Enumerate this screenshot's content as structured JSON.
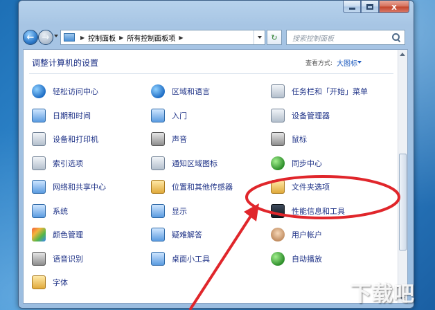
{
  "window": {
    "nav": {
      "back_glyph": "←",
      "forward_glyph": "→",
      "breadcrumb": [
        "控制面板",
        "所有控制面板项"
      ],
      "breadcrumb_sep": "▶",
      "refresh_glyph": "↻",
      "search_placeholder": "搜索控制面板"
    },
    "close_glyph": "x"
  },
  "content": {
    "title": "调整计算机的设置",
    "view_by_label": "查看方式:",
    "view_by_value": "大图标",
    "columns": [
      [
        {
          "label": "轻松访问中心",
          "icon": "ease-of-access-icon",
          "color": "a"
        },
        {
          "label": "日期和时间",
          "icon": "clock-calendar-icon",
          "color": "e"
        },
        {
          "label": "设备和打印机",
          "icon": "printer-icon",
          "color": "c"
        },
        {
          "label": "索引选项",
          "icon": "magnifier-icon",
          "color": "c"
        },
        {
          "label": "网络和共享中心",
          "icon": "network-icon",
          "color": "e"
        },
        {
          "label": "系统",
          "icon": "computer-icon",
          "color": "e"
        },
        {
          "label": "颜色管理",
          "icon": "color-management-icon",
          "color": "g"
        },
        {
          "label": "语音识别",
          "icon": "microphone-icon",
          "color": "f"
        },
        {
          "label": "字体",
          "icon": "font-icon",
          "color": "d"
        }
      ],
      [
        {
          "label": "区域和语言",
          "icon": "globe-icon",
          "color": "a"
        },
        {
          "label": "入门",
          "icon": "getting-started-icon",
          "color": "e"
        },
        {
          "label": "声音",
          "icon": "speaker-icon",
          "color": "f"
        },
        {
          "label": "通知区域图标",
          "icon": "tray-icon",
          "color": "c"
        },
        {
          "label": "位置和其他传感器",
          "icon": "sensor-icon",
          "color": "d"
        },
        {
          "label": "显示",
          "icon": "display-icon",
          "color": "e"
        },
        {
          "label": "疑难解答",
          "icon": "troubleshoot-icon",
          "color": "e"
        },
        {
          "label": "桌面小工具",
          "icon": "gadgets-icon",
          "color": "e"
        }
      ],
      [
        {
          "label": "任务栏和「开始」菜单",
          "icon": "taskbar-icon",
          "color": "c"
        },
        {
          "label": "设备管理器",
          "icon": "device-manager-icon",
          "color": "c"
        },
        {
          "label": "鼠标",
          "icon": "mouse-icon",
          "color": "f"
        },
        {
          "label": "同步中心",
          "icon": "sync-icon",
          "color": "b"
        },
        {
          "label": "文件夹选项",
          "icon": "folder-icon",
          "color": "d"
        },
        {
          "label": "性能信息和工具",
          "icon": "performance-icon",
          "color": "h"
        },
        {
          "label": "用户帐户",
          "icon": "users-icon",
          "color": "i"
        },
        {
          "label": "自动播放",
          "icon": "autoplay-icon",
          "color": "b"
        }
      ]
    ]
  },
  "annotation": {
    "color": "#e0262b"
  },
  "watermark": "下载吧"
}
